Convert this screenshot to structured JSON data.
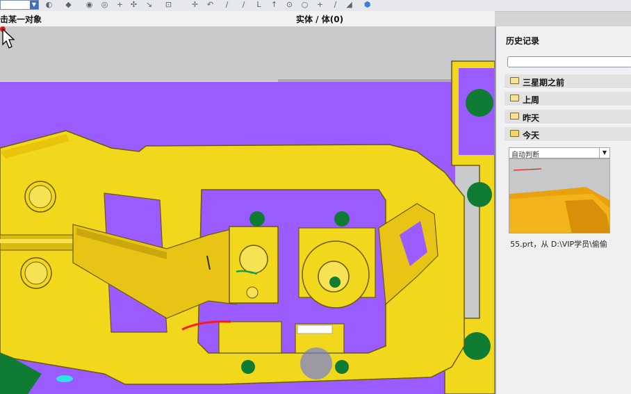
{
  "toolbar": {
    "icons": [
      "view-icon",
      "snap-icon",
      "layer-icon",
      "sketch-icon",
      "point-icon",
      "move-icon",
      "extrude-icon",
      "dimension-icon",
      "line-icon",
      "arc-icon",
      "circle-icon",
      "spline-icon",
      "plus-icon",
      "shade-icon"
    ]
  },
  "statusbar": {
    "prompt": "击某一对象",
    "selection": "实体 / 体(0)"
  },
  "history": {
    "title": "历史记录",
    "groups": [
      {
        "label": "三星期之前"
      },
      {
        "label": "上周"
      },
      {
        "label": "昨天"
      },
      {
        "label": "今天"
      }
    ],
    "filter": "自动判断",
    "file_caption": "55.prt，从 D:\\VIP学员\\偷偷"
  },
  "colors": {
    "background": "#9a5bff",
    "part": "#f2d81c",
    "part_shade": "#d8ba10",
    "holes": "#0f7b33",
    "cursor": "#6e78eb"
  }
}
